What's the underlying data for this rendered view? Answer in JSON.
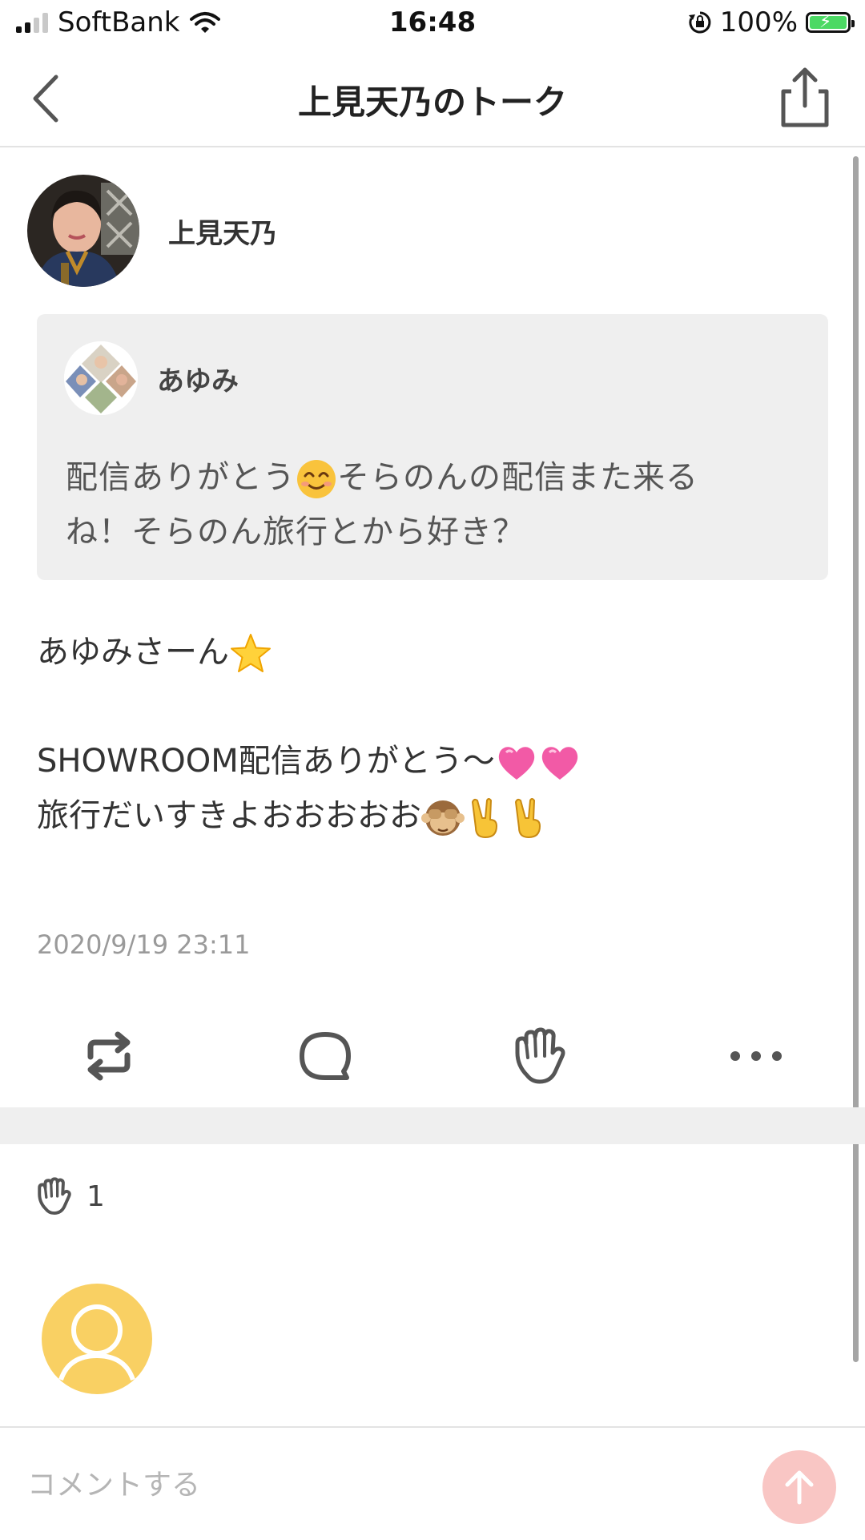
{
  "status_bar": {
    "carrier": "SoftBank",
    "time": "16:48",
    "battery": "100%"
  },
  "nav": {
    "title": "上見天乃のトーク"
  },
  "post": {
    "author": "上見天乃",
    "quote": {
      "author": "あゆみ",
      "line1a": "配信ありがとう",
      "line1b": "そらのんの配信また来る",
      "line2": "ね！そらのん旅行とから好き？"
    },
    "reply": {
      "greeting": "あゆみさーん",
      "line1": "SHOWROOM配信ありがとう〜",
      "line2": "旅行だいすきよおおおおお"
    },
    "timestamp": "2020/9/19 23:11"
  },
  "actions": [
    "repost-icon",
    "comment-icon",
    "clap-icon",
    "more-icon"
  ],
  "claps": {
    "count": "1"
  },
  "comment": {
    "placeholder": "コメントする"
  },
  "colors": {
    "clap_avatar": "#f9d063",
    "send_button": "#f9c6c4",
    "gray_bg": "#efefef"
  }
}
